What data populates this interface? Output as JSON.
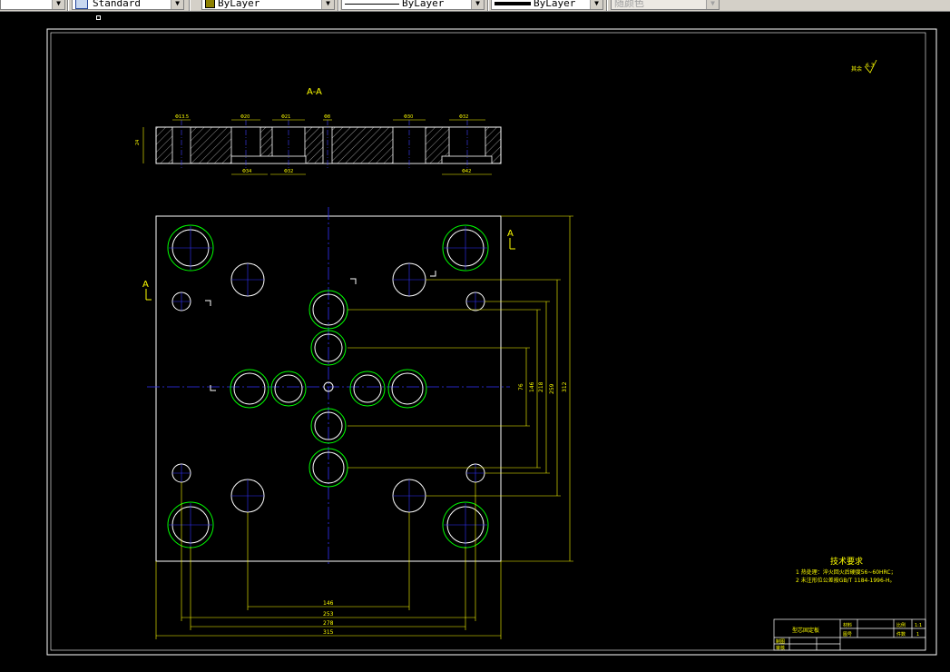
{
  "toolbar": {
    "text_style": "Standard",
    "color": "ByLayer",
    "linetype": "ByLayer",
    "lineweight": "ByLayer",
    "plot_style": "随颜色"
  },
  "drawing": {
    "section_title": "A-A",
    "section_mark": "A",
    "roughness_symbol": "6.3",
    "section_dims": {
      "top": [
        "Φ13.5",
        "Φ20",
        "Φ21",
        "Φ8",
        "Φ30",
        "Φ32"
      ],
      "bottom": [
        "Φ34",
        "Φ32",
        "Φ42"
      ],
      "height": "24"
    },
    "plan_dims": {
      "horizontal": [
        "146",
        "253",
        "278",
        "315"
      ],
      "vertical": [
        "76",
        "146",
        "218",
        "259",
        "312"
      ]
    },
    "tech_requirements": {
      "title": "技术要求",
      "items": [
        "1  热处理：淬火回火后硬度56~60HRC；",
        "2  未注形位公差按GB/T 1184-1996-H。"
      ]
    },
    "title_block": {
      "part_name": "型芯固定板",
      "material_label": "材料",
      "scale_label": "比例",
      "scale_value": "1:1",
      "quantity_label": "件数",
      "quantity_value": "1",
      "drawing_no_label": "图号",
      "designer_label": "制图",
      "checker_label": "审核"
    }
  },
  "colors": {
    "background": "#000000",
    "outline": "#ffffff",
    "dimension": "#ffff00",
    "centerline": "#0000ff",
    "hole_green": "#00ff00",
    "hatch": "#ffffff"
  }
}
